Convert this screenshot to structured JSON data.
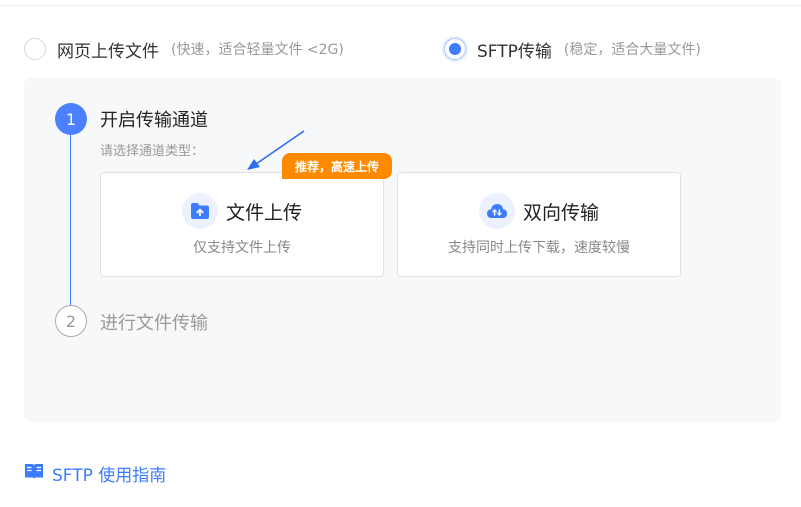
{
  "upload_mode": {
    "web": {
      "label": "网页上传文件",
      "hint": "(快速，适合轻量文件 <2G)",
      "selected": false
    },
    "sftp": {
      "label": "SFTP传输",
      "hint": "(稳定，适合大量文件)",
      "selected": true
    }
  },
  "steps": [
    {
      "number": "1",
      "title": "开启传输通道",
      "hint": "请选择通道类型："
    },
    {
      "number": "2",
      "title": "进行文件传输"
    }
  ],
  "channels": [
    {
      "icon": "folder-upload-icon",
      "title": "文件上传",
      "desc": "仅支持文件上传",
      "badge": "推荐，高速上传"
    },
    {
      "icon": "cloud-sync-icon",
      "title": "双向传输",
      "desc": "支持同时上传下载，速度较慢"
    }
  ],
  "guide_link": {
    "icon": "book-icon",
    "label": "SFTP 使用指南"
  },
  "colors": {
    "accent": "#3d7bff",
    "badge": "#ff8a00",
    "panel": "#f7f8fa"
  }
}
